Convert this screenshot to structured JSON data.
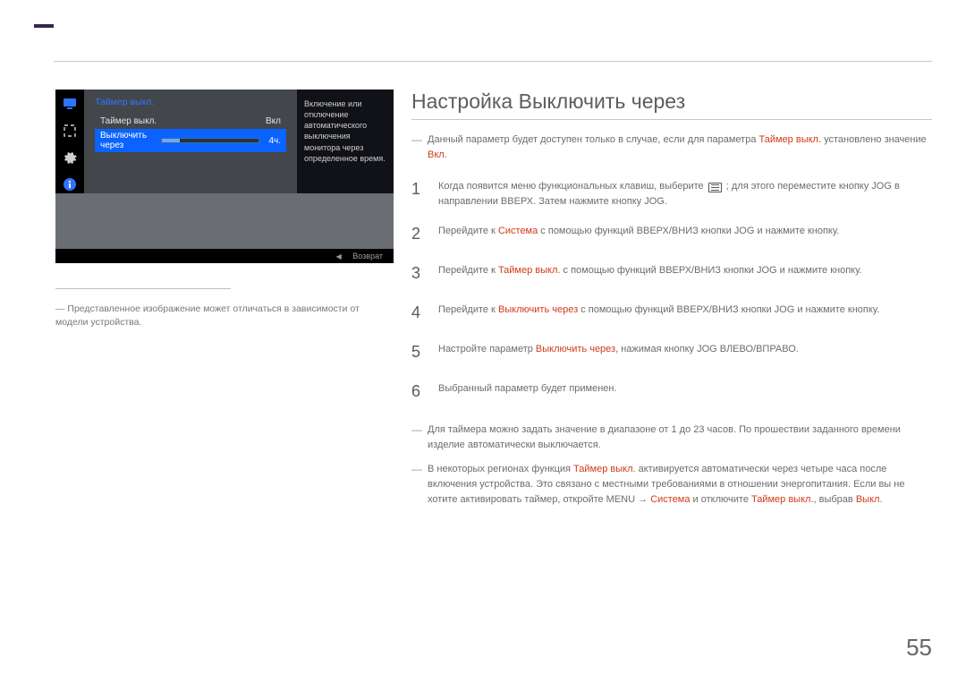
{
  "page_number": "55",
  "section_title": "Настройка Выключить через",
  "osd": {
    "title": "Таймер выкл.",
    "row1_label": "Таймер выкл.",
    "row1_value": "Вкл",
    "row2_label": "Выключить через",
    "row2_value": "4ч.",
    "desc": "Включение или отключение автоматического выключения монитора через определенное время.",
    "footer_return": "Возврат"
  },
  "caption_prefix": "― ",
  "caption_text": "Представленное изображение может отличаться в зависимости от модели устройства.",
  "intro_note_a": "Данный параметр будет доступен только в случае, если для параметра ",
  "intro_note_b": "Таймер выкл.",
  "intro_note_c": " установлено значение ",
  "intro_note_d": "Вкл",
  "intro_note_e": ".",
  "step1_a": "Когда появится меню функциональных клавиш, выберите ",
  "step1_b": " ; для этого переместите кнопку JOG в направлении ВВЕРХ. Затем нажмите кнопку JOG.",
  "step2_a": "Перейдите к ",
  "step2_b": "Система",
  "step2_c": " с помощью функций ВВЕРХ/ВНИЗ кнопки JOG и нажмите кнопку.",
  "step3_a": "Перейдите к ",
  "step3_b": "Таймер выкл.",
  "step3_c": " с помощью функций ВВЕРХ/ВНИЗ кнопки JOG и нажмите кнопку.",
  "step4_a": "Перейдите к ",
  "step4_b": "Выключить через",
  "step4_c": " с помощью функций ВВЕРХ/ВНИЗ кнопки JOG и нажмите кнопку.",
  "step5_a": "Настройте параметр ",
  "step5_b": "Выключить через",
  "step5_c": ", нажимая кнопку JOG ВЛЕВО/ВПРАВО.",
  "step6": "Выбранный параметр будет применен.",
  "footnote1": "Для таймера можно задать значение в диапазоне от 1 до 23 часов. По прошествии заданного времени изделие автоматически выключается.",
  "footnote2_a": "В некоторых регионах функция ",
  "footnote2_b": "Таймер выкл.",
  "footnote2_c": " активируется автоматически через четыре часа после включения устройства. Это связано с местными требованиями в отношении энергопитания. Если вы не хотите активировать таймер, откройте MENU → ",
  "footnote2_d": "Система",
  "footnote2_e": " и отключите ",
  "footnote2_f": "Таймер выкл.",
  "footnote2_g": ", выбрав ",
  "footnote2_h": "Выкл",
  "footnote2_i": "."
}
